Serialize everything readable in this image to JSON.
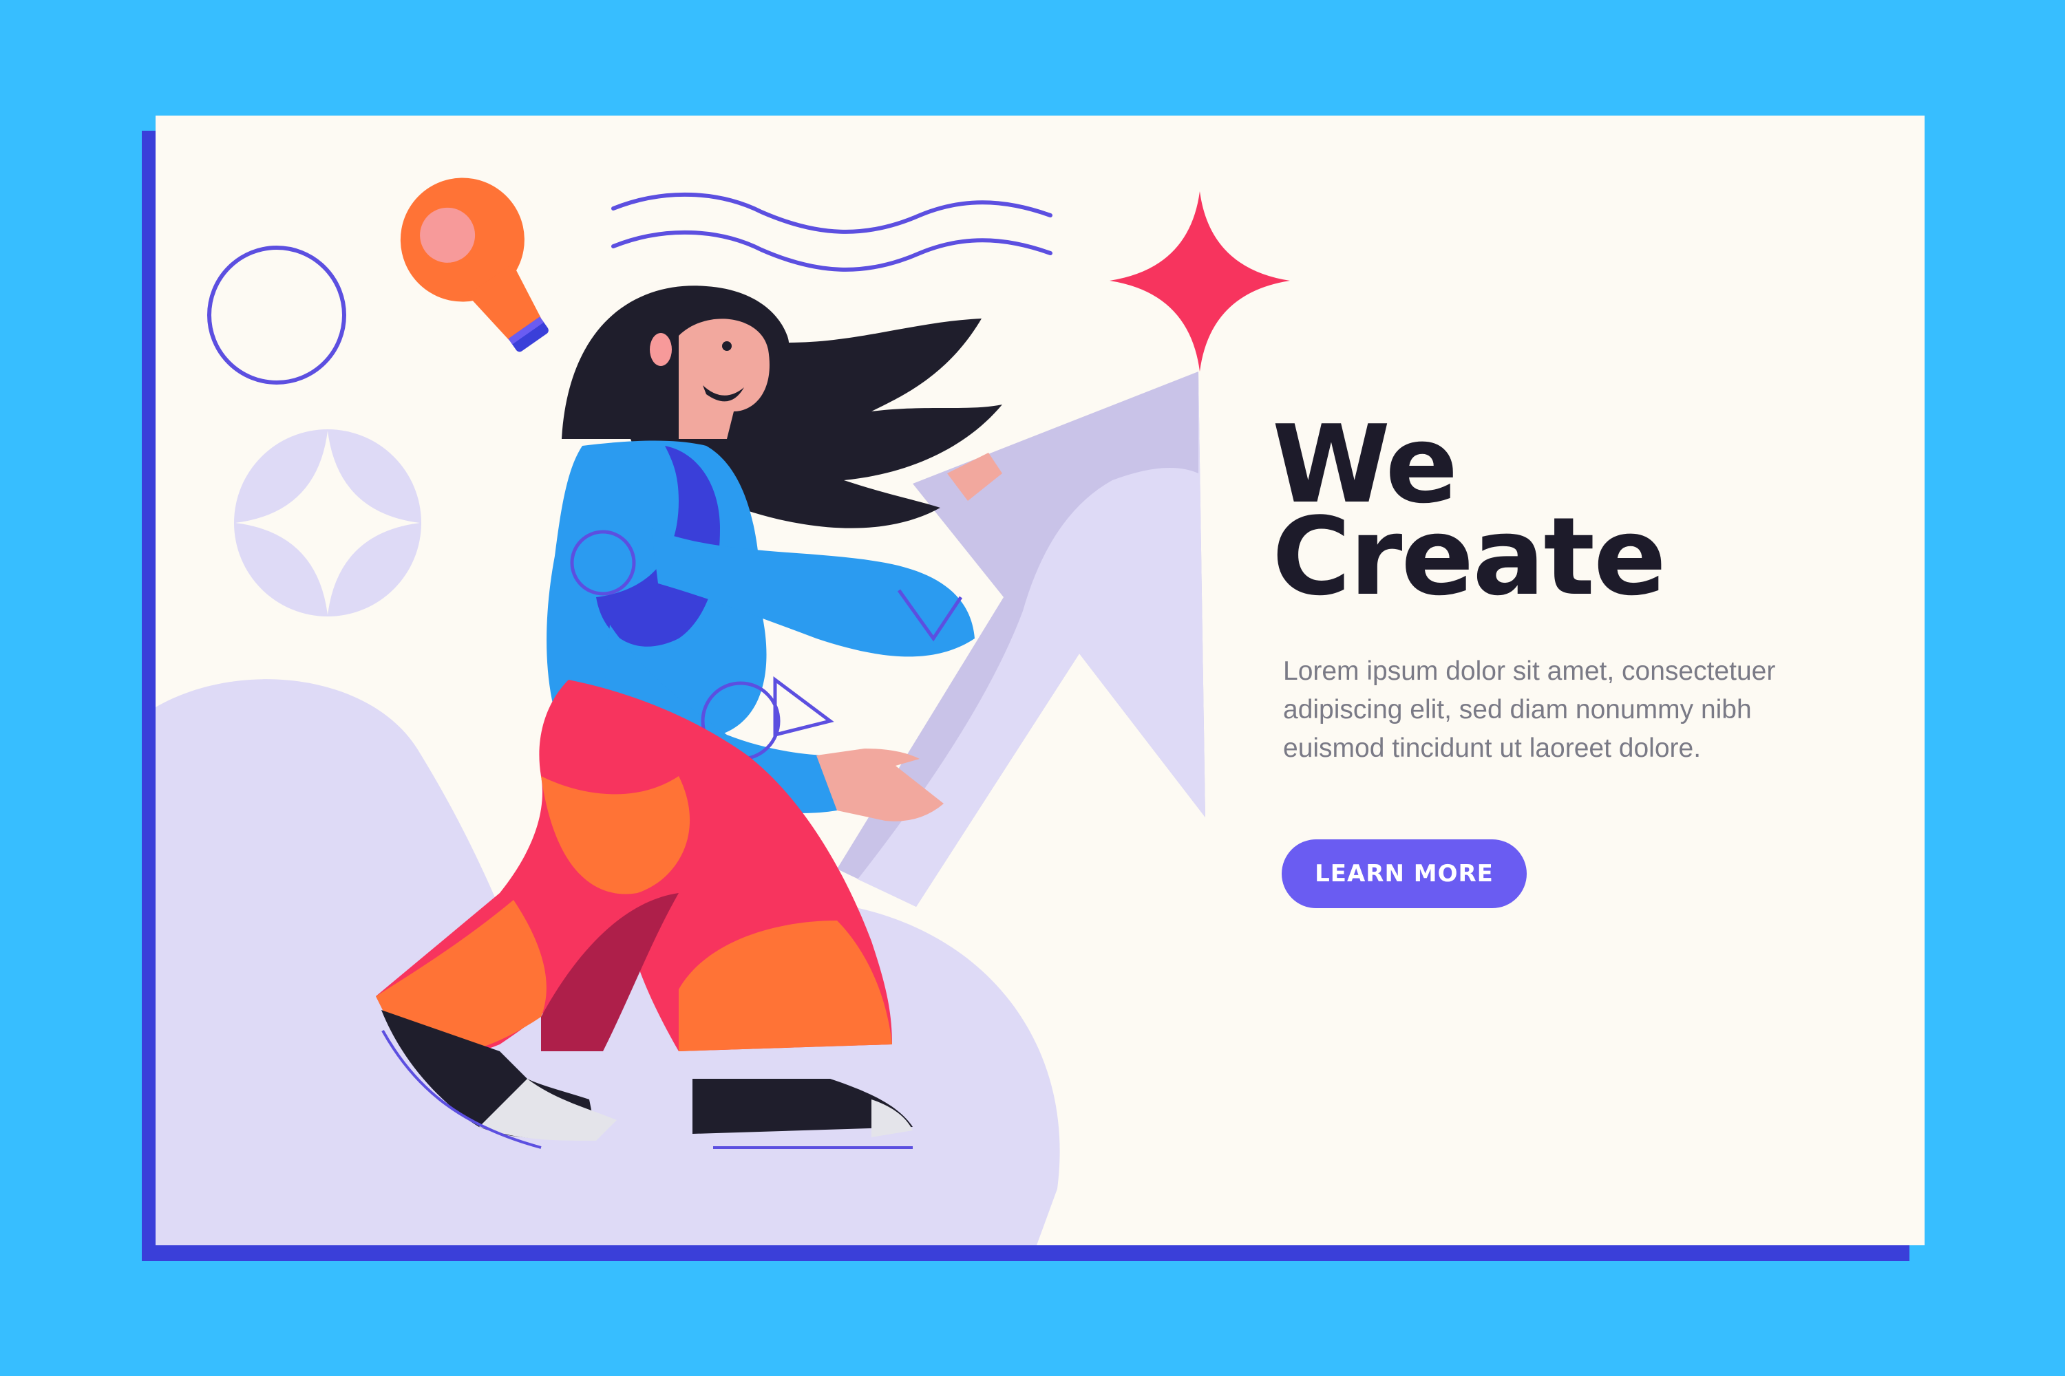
{
  "hero": {
    "title_line1": "We",
    "title_line2": "Create",
    "body": "Lorem ipsum dolor sit amet, consectetuer adipiscing elit, sed diam nonummy nibh euismod tincidunt ut laoreet dolore.",
    "cta_label": "LEARN MORE"
  },
  "colors": {
    "background": "#37BEFF",
    "card": "#FDFAF3",
    "card_shadow": "#3A3FD9",
    "accent": "#6A5CF2",
    "title_text": "#1D1B2A",
    "body_text": "#7A7A86",
    "star": "#F7345E",
    "arrow": "#C9C3E8"
  },
  "icons": [
    "lightbulb-icon",
    "circle-outline-icon",
    "wave-lines-icon",
    "sparkle-star-icon",
    "four-point-star-badge-icon",
    "cursor-arrow-icon"
  ]
}
